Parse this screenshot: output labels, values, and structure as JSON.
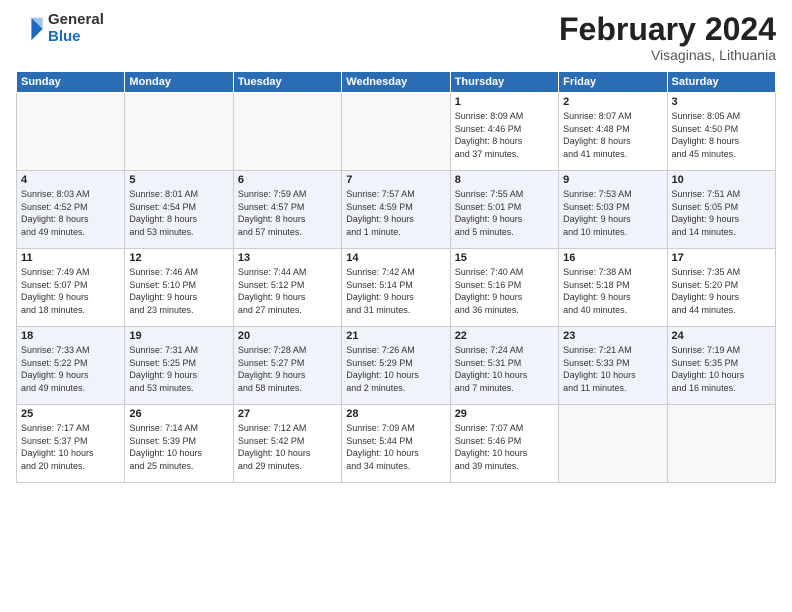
{
  "header": {
    "logo_general": "General",
    "logo_blue": "Blue",
    "month_title": "February 2024",
    "subtitle": "Visaginas, Lithuania"
  },
  "weekdays": [
    "Sunday",
    "Monday",
    "Tuesday",
    "Wednesday",
    "Thursday",
    "Friday",
    "Saturday"
  ],
  "weeks": [
    [
      {
        "day": "",
        "info": ""
      },
      {
        "day": "",
        "info": ""
      },
      {
        "day": "",
        "info": ""
      },
      {
        "day": "",
        "info": ""
      },
      {
        "day": "1",
        "info": "Sunrise: 8:09 AM\nSunset: 4:46 PM\nDaylight: 8 hours\nand 37 minutes."
      },
      {
        "day": "2",
        "info": "Sunrise: 8:07 AM\nSunset: 4:48 PM\nDaylight: 8 hours\nand 41 minutes."
      },
      {
        "day": "3",
        "info": "Sunrise: 8:05 AM\nSunset: 4:50 PM\nDaylight: 8 hours\nand 45 minutes."
      }
    ],
    [
      {
        "day": "4",
        "info": "Sunrise: 8:03 AM\nSunset: 4:52 PM\nDaylight: 8 hours\nand 49 minutes."
      },
      {
        "day": "5",
        "info": "Sunrise: 8:01 AM\nSunset: 4:54 PM\nDaylight: 8 hours\nand 53 minutes."
      },
      {
        "day": "6",
        "info": "Sunrise: 7:59 AM\nSunset: 4:57 PM\nDaylight: 8 hours\nand 57 minutes."
      },
      {
        "day": "7",
        "info": "Sunrise: 7:57 AM\nSunset: 4:59 PM\nDaylight: 9 hours\nand 1 minute."
      },
      {
        "day": "8",
        "info": "Sunrise: 7:55 AM\nSunset: 5:01 PM\nDaylight: 9 hours\nand 5 minutes."
      },
      {
        "day": "9",
        "info": "Sunrise: 7:53 AM\nSunset: 5:03 PM\nDaylight: 9 hours\nand 10 minutes."
      },
      {
        "day": "10",
        "info": "Sunrise: 7:51 AM\nSunset: 5:05 PM\nDaylight: 9 hours\nand 14 minutes."
      }
    ],
    [
      {
        "day": "11",
        "info": "Sunrise: 7:49 AM\nSunset: 5:07 PM\nDaylight: 9 hours\nand 18 minutes."
      },
      {
        "day": "12",
        "info": "Sunrise: 7:46 AM\nSunset: 5:10 PM\nDaylight: 9 hours\nand 23 minutes."
      },
      {
        "day": "13",
        "info": "Sunrise: 7:44 AM\nSunset: 5:12 PM\nDaylight: 9 hours\nand 27 minutes."
      },
      {
        "day": "14",
        "info": "Sunrise: 7:42 AM\nSunset: 5:14 PM\nDaylight: 9 hours\nand 31 minutes."
      },
      {
        "day": "15",
        "info": "Sunrise: 7:40 AM\nSunset: 5:16 PM\nDaylight: 9 hours\nand 36 minutes."
      },
      {
        "day": "16",
        "info": "Sunrise: 7:38 AM\nSunset: 5:18 PM\nDaylight: 9 hours\nand 40 minutes."
      },
      {
        "day": "17",
        "info": "Sunrise: 7:35 AM\nSunset: 5:20 PM\nDaylight: 9 hours\nand 44 minutes."
      }
    ],
    [
      {
        "day": "18",
        "info": "Sunrise: 7:33 AM\nSunset: 5:22 PM\nDaylight: 9 hours\nand 49 minutes."
      },
      {
        "day": "19",
        "info": "Sunrise: 7:31 AM\nSunset: 5:25 PM\nDaylight: 9 hours\nand 53 minutes."
      },
      {
        "day": "20",
        "info": "Sunrise: 7:28 AM\nSunset: 5:27 PM\nDaylight: 9 hours\nand 58 minutes."
      },
      {
        "day": "21",
        "info": "Sunrise: 7:26 AM\nSunset: 5:29 PM\nDaylight: 10 hours\nand 2 minutes."
      },
      {
        "day": "22",
        "info": "Sunrise: 7:24 AM\nSunset: 5:31 PM\nDaylight: 10 hours\nand 7 minutes."
      },
      {
        "day": "23",
        "info": "Sunrise: 7:21 AM\nSunset: 5:33 PM\nDaylight: 10 hours\nand 11 minutes."
      },
      {
        "day": "24",
        "info": "Sunrise: 7:19 AM\nSunset: 5:35 PM\nDaylight: 10 hours\nand 16 minutes."
      }
    ],
    [
      {
        "day": "25",
        "info": "Sunrise: 7:17 AM\nSunset: 5:37 PM\nDaylight: 10 hours\nand 20 minutes."
      },
      {
        "day": "26",
        "info": "Sunrise: 7:14 AM\nSunset: 5:39 PM\nDaylight: 10 hours\nand 25 minutes."
      },
      {
        "day": "27",
        "info": "Sunrise: 7:12 AM\nSunset: 5:42 PM\nDaylight: 10 hours\nand 29 minutes."
      },
      {
        "day": "28",
        "info": "Sunrise: 7:09 AM\nSunset: 5:44 PM\nDaylight: 10 hours\nand 34 minutes."
      },
      {
        "day": "29",
        "info": "Sunrise: 7:07 AM\nSunset: 5:46 PM\nDaylight: 10 hours\nand 39 minutes."
      },
      {
        "day": "",
        "info": ""
      },
      {
        "day": "",
        "info": ""
      }
    ]
  ]
}
